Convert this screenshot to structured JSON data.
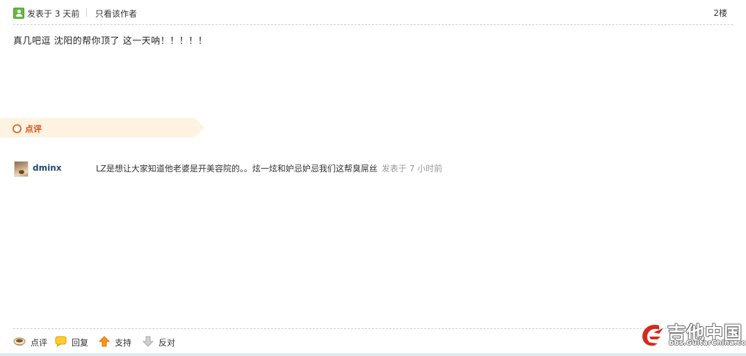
{
  "post": {
    "posted_at": "发表于 3 天前",
    "only_author": "只看该作者",
    "floor": "2楼",
    "body": "真几吧逗  沈阳的帮你顶了  这一天呐！！！！！"
  },
  "comments_section": {
    "title": "点评",
    "items": [
      {
        "user": "dminx",
        "text": "LZ是想让大家知道他老婆是开美容院的。。炫一炫和妒忌妒忌我们这帮臭屌丝",
        "time": "发表于 7 小时前"
      }
    ]
  },
  "actions": {
    "comment": "点评",
    "reply": "回复",
    "support": "支持",
    "oppose": "反对"
  },
  "watermark": {
    "brand": "吉他中国",
    "url": "bbs.GuitarChina.com"
  },
  "colors": {
    "accent_orange": "#d9531e",
    "username_blue": "#24496d",
    "comment_bar_bg": "#fdf3e0",
    "online_green": "#67b846"
  },
  "icons": {
    "online": "user-online-icon",
    "comment_ring": "ring-icon",
    "comment": "cup-icon",
    "reply": "speech-bubble-icon",
    "support": "arrow-up-icon",
    "oppose": "arrow-down-icon"
  }
}
